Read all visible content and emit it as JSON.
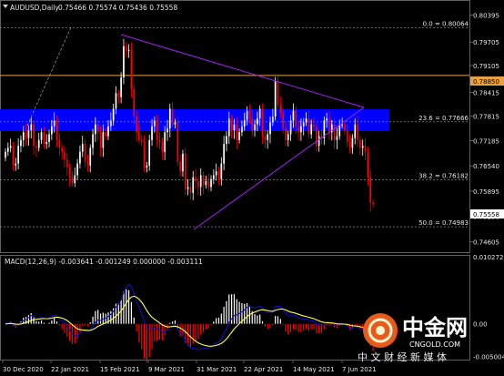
{
  "header": {
    "symbol_timeframe": "AUDUSD,Daily",
    "ohlc": "0.75466 0.75574 0.75436 0.75558"
  },
  "macd_header": "MACD(12,26,9) -0.003641 -0.001249 0.000000 -0.003111",
  "price_axis": {
    "ticks": [
      "0.80395",
      "0.79705",
      "0.79105",
      "0.78415",
      "0.77815",
      "0.77185",
      "0.76540",
      "0.75895",
      "0.75250",
      "0.74605"
    ],
    "current_price": "0.75558",
    "hline_price": "0.78850"
  },
  "macd_axis": {
    "ticks": [
      "0.010272",
      "0.00",
      "-0.005004"
    ]
  },
  "fib_levels": [
    {
      "label": "0.0 = 0.80064"
    },
    {
      "label": "23.6 = 0.77666"
    },
    {
      "label": "38.2 = 0.76182"
    },
    {
      "label": "50.0 = 0.74983"
    }
  ],
  "x_axis": {
    "labels": [
      "30 Dec 2020",
      "22 Jan 2021",
      "15 Feb 2021",
      "9 Mar 2021",
      "31 Mar 2021",
      "22 Apr 2021",
      "14 May 2021",
      "7 Jun 2021"
    ]
  },
  "watermark": {
    "brand": "中金网",
    "domain": "CNGOLD.COM",
    "tagline": "中 文 财 经 新 媒 体"
  },
  "colors": {
    "background": "#000000",
    "bull": "#ffffff",
    "bear": "#ff0000",
    "blue_zone": "#0000ff",
    "triangle": "#a020f0",
    "hline": "#e8a040",
    "macd_line": "#1010c0",
    "signal_line": "#ffff40"
  },
  "chart_data": [
    {
      "type": "candlestick",
      "title": "AUDUSD,Daily",
      "x_labels": [
        "30 Dec 2020",
        "22 Jan 2021",
        "15 Feb 2021",
        "9 Mar 2021",
        "31 Mar 2021",
        "22 Apr 2021",
        "14 May 2021",
        "7 Jun 2021"
      ],
      "ylim": [
        0.7445,
        0.805
      ],
      "horizontal_line": 0.7885,
      "current_price": 0.75558,
      "fibonacci": [
        {
          "level": 0.0,
          "price": 0.80064
        },
        {
          "level": 23.6,
          "price": 0.77666
        },
        {
          "level": 38.2,
          "price": 0.76182
        },
        {
          "level": 50.0,
          "price": 0.74983
        }
      ],
      "zone": {
        "low": 0.7765,
        "high": 0.7815
      },
      "closes": [
        0.769,
        0.77,
        0.7705,
        0.7655,
        0.766,
        0.7705,
        0.772,
        0.774,
        0.7725,
        0.7745,
        0.776,
        0.7705,
        0.77,
        0.772,
        0.774,
        0.771,
        0.7715,
        0.7735,
        0.7755,
        0.777,
        0.772,
        0.77,
        0.769,
        0.767,
        0.765,
        0.7625,
        0.761,
        0.763,
        0.766,
        0.769,
        0.771,
        0.7665,
        0.7655,
        0.77,
        0.7735,
        0.776,
        0.774,
        0.77,
        0.774,
        0.773,
        0.7755,
        0.777,
        0.78,
        0.784,
        0.783,
        0.788,
        0.796,
        0.795,
        0.795,
        0.785,
        0.778,
        0.774,
        0.772,
        0.7715,
        0.765,
        0.7655,
        0.772,
        0.7755,
        0.777,
        0.772,
        0.7715,
        0.769,
        0.774,
        0.775,
        0.78,
        0.776,
        0.7765,
        0.7665,
        0.764,
        0.7685,
        0.7595,
        0.76,
        0.7585,
        0.7625,
        0.7615,
        0.76,
        0.763,
        0.7605,
        0.7615,
        0.76,
        0.762,
        0.763,
        0.764,
        0.762,
        0.766,
        0.771,
        0.773,
        0.7775,
        0.7745,
        0.776,
        0.772,
        0.774,
        0.7755,
        0.777,
        0.7795,
        0.7775,
        0.7745,
        0.776,
        0.7775,
        0.78,
        0.773,
        0.772,
        0.7735,
        0.7765,
        0.778,
        0.787,
        0.781,
        0.779,
        0.775,
        0.772,
        0.7735,
        0.777,
        0.7795,
        0.7755,
        0.774,
        0.7755,
        0.7765,
        0.7775,
        0.7735,
        0.776,
        0.7755,
        0.7705,
        0.773,
        0.7725,
        0.777,
        0.7775,
        0.774,
        0.776,
        0.772,
        0.773,
        0.776,
        0.776,
        0.7745,
        0.7715,
        0.77,
        0.7725,
        0.776,
        0.772,
        0.77,
        0.7705,
        0.769,
        0.7625,
        0.756,
        0.7556
      ]
    },
    {
      "type": "macd",
      "title": "MACD(12,26,9)",
      "ylim": [
        -0.0055,
        0.0103
      ],
      "values": [
        -0.003641,
        -0.001249,
        0.0,
        -0.003111
      ]
    }
  ]
}
